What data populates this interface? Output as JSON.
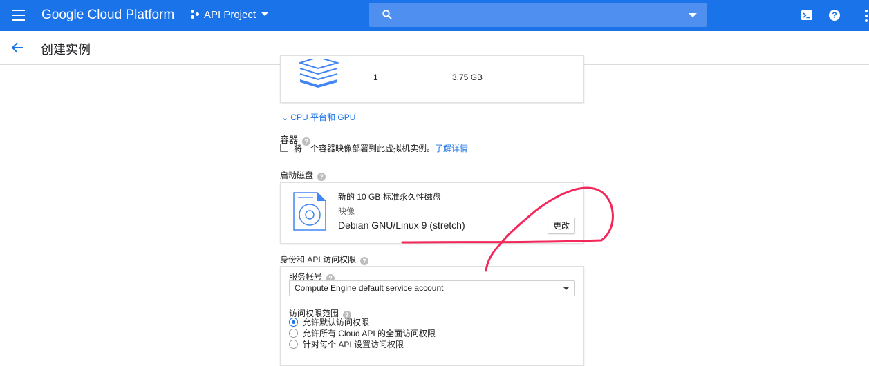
{
  "topbar": {
    "brand": "Google Cloud Platform",
    "project": "API Project",
    "search_placeholder": ""
  },
  "page": {
    "title": "创建实例"
  },
  "machine": {
    "cores": "1",
    "memory": "3.75 GB"
  },
  "cpu_platform_link": "CPU 平台和 GPU",
  "container": {
    "heading": "容器",
    "checkbox_label": "将一个容器映像部署到此虚拟机实例。",
    "learn_more": "了解详情"
  },
  "boot_disk": {
    "heading": "启动磁盘",
    "description": "新的 10 GB 标准永久性磁盘",
    "image_label": "映像",
    "image_name": "Debian GNU/Linux 9 (stretch)",
    "change_button": "更改"
  },
  "identity": {
    "heading": "身份和 API 访问权限",
    "service_account_label": "服务帐号",
    "service_account_value": "Compute Engine default service account",
    "scopes_label": "访问权限范围",
    "scopes": [
      {
        "label": "允许默认访问权限",
        "selected": true
      },
      {
        "label": "允许所有 Cloud API 的全面访问权限",
        "selected": false
      },
      {
        "label": "针对每个 API 设置访问权限",
        "selected": false
      }
    ]
  },
  "colors": {
    "brand_blue": "#1a73e8",
    "annotation_red": "#f2285a"
  }
}
